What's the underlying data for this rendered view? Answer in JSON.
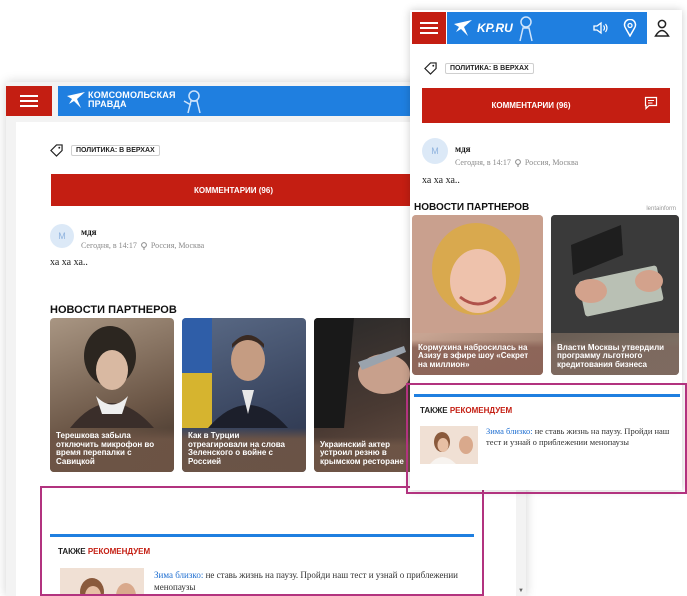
{
  "site": {
    "desktop_logo_text": "КОМСОМОЛЬСКАЯ ПРАВДА",
    "mobile_logo_text": "KP.RU"
  },
  "tag_label": "ПОЛИТИКА: В ВЕРХАХ",
  "comments_button": "КОММЕНТАРИИ (96)",
  "comment": {
    "avatar_letter": "М",
    "author": "мдя",
    "time": "Сегодня, в 14:17",
    "location": "Россия, Москва",
    "text": "ха ха ха.."
  },
  "partners": {
    "title": "НОВОСТИ ПАРТНЕРОВ",
    "source": "lentainform",
    "desktop_cards": [
      {
        "caption": "Терешкова забыла отключить микрофон во время перепалки с Савицкой"
      },
      {
        "caption": "Как в Турции отреагировали на слова Зеленского о войне с Россией"
      },
      {
        "caption": "Украинский актер устроил резню в крымском ресторане"
      }
    ],
    "mobile_cards": [
      {
        "caption": "Кормухина набросилась на Азизу в эфире шоу «Секрет на миллион»"
      },
      {
        "caption": "Власти Москвы утвердили программу льготного кредитования бизнеса"
      }
    ]
  },
  "recommend": {
    "title_part1": "ТАКЖЕ ",
    "title_part2": "РЕКОМЕНДУЕМ",
    "link_text": "Зима близко:",
    "body_text": " не ставь жизнь на паузу. Пройди наш тест и узнай о приблежении менопаузы"
  },
  "colors": {
    "brand_red": "#c41e12",
    "brand_blue": "#1f7fe0",
    "highlight": "#b2337f"
  },
  "icons": [
    "menu-icon",
    "tag-icon",
    "clock-icon",
    "location-icon",
    "sound-icon",
    "map-pin-icon",
    "user-icon",
    "comment-icon"
  ]
}
